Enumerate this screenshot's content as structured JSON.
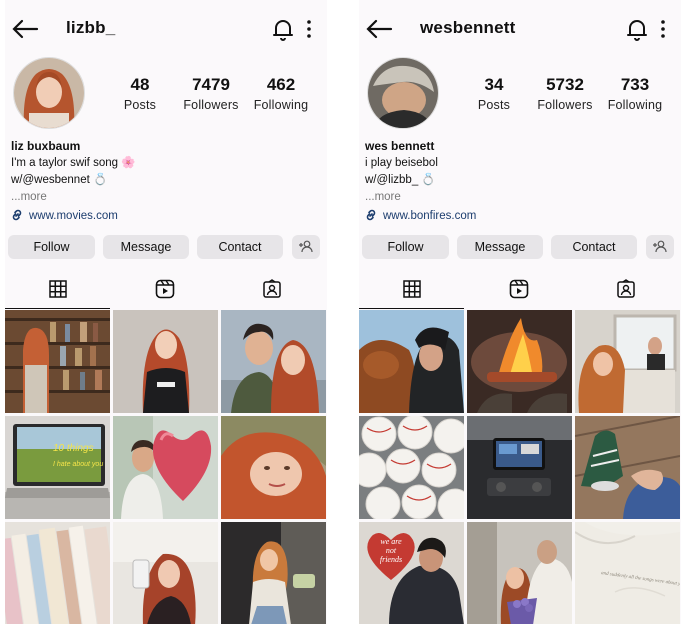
{
  "profiles": [
    {
      "username": "lizbb_",
      "stats": [
        {
          "value": "48",
          "label": "Posts"
        },
        {
          "value": "7479",
          "label": "Followers"
        },
        {
          "value": "462",
          "label": "Following"
        }
      ],
      "display_name": "liz buxbaum",
      "bio_line1": "I'm a taylor swif song 🌸",
      "bio_line2": "w/@wesbennet 💍",
      "more": "...more",
      "link": "www.movies.com",
      "buttons": {
        "follow": "Follow",
        "message": "Message",
        "contact": "Contact"
      },
      "grid_images": [
        {
          "scene": "bookshelf"
        },
        {
          "scene": "girl-tshirt"
        },
        {
          "scene": "couple-selfie"
        },
        {
          "scene": "laptop-poster",
          "poster_text_1": "10 things",
          "poster_text_2": "I hate about you"
        },
        {
          "scene": "heart-balloon"
        },
        {
          "scene": "redhead-closeup"
        },
        {
          "scene": "book-spines"
        },
        {
          "scene": "phone-mirror"
        },
        {
          "scene": "sitting-girl"
        }
      ]
    },
    {
      "username": "wesbennett",
      "stats": [
        {
          "value": "34",
          "label": "Posts"
        },
        {
          "value": "5732",
          "label": "Followers"
        },
        {
          "value": "733",
          "label": "Following"
        }
      ],
      "display_name": "wes bennett",
      "bio_line1": "i play beisebol",
      "bio_line2": "w/@lizbb_ 💍",
      "more": "...more",
      "link": "www.bonfires.com",
      "buttons": {
        "follow": "Follow",
        "message": "Message",
        "contact": "Contact"
      },
      "grid_images": [
        {
          "scene": "dog-kiss"
        },
        {
          "scene": "campfire"
        },
        {
          "scene": "window-selfie"
        },
        {
          "scene": "baseballs"
        },
        {
          "scene": "car-dashboard"
        },
        {
          "scene": "sneakers"
        },
        {
          "scene": "heart-sign",
          "sign_text_1": "we are",
          "sign_text_2": "not",
          "sign_text_3": "friends"
        },
        {
          "scene": "flowers-couple"
        },
        {
          "scene": "sweatshirt",
          "shirt_text": "and suddenly all the songs were about you"
        }
      ]
    }
  ],
  "colors": {
    "button_bg": "#e7e5e8",
    "link": "#1c3d6e",
    "bg": "#fbf9fb"
  }
}
